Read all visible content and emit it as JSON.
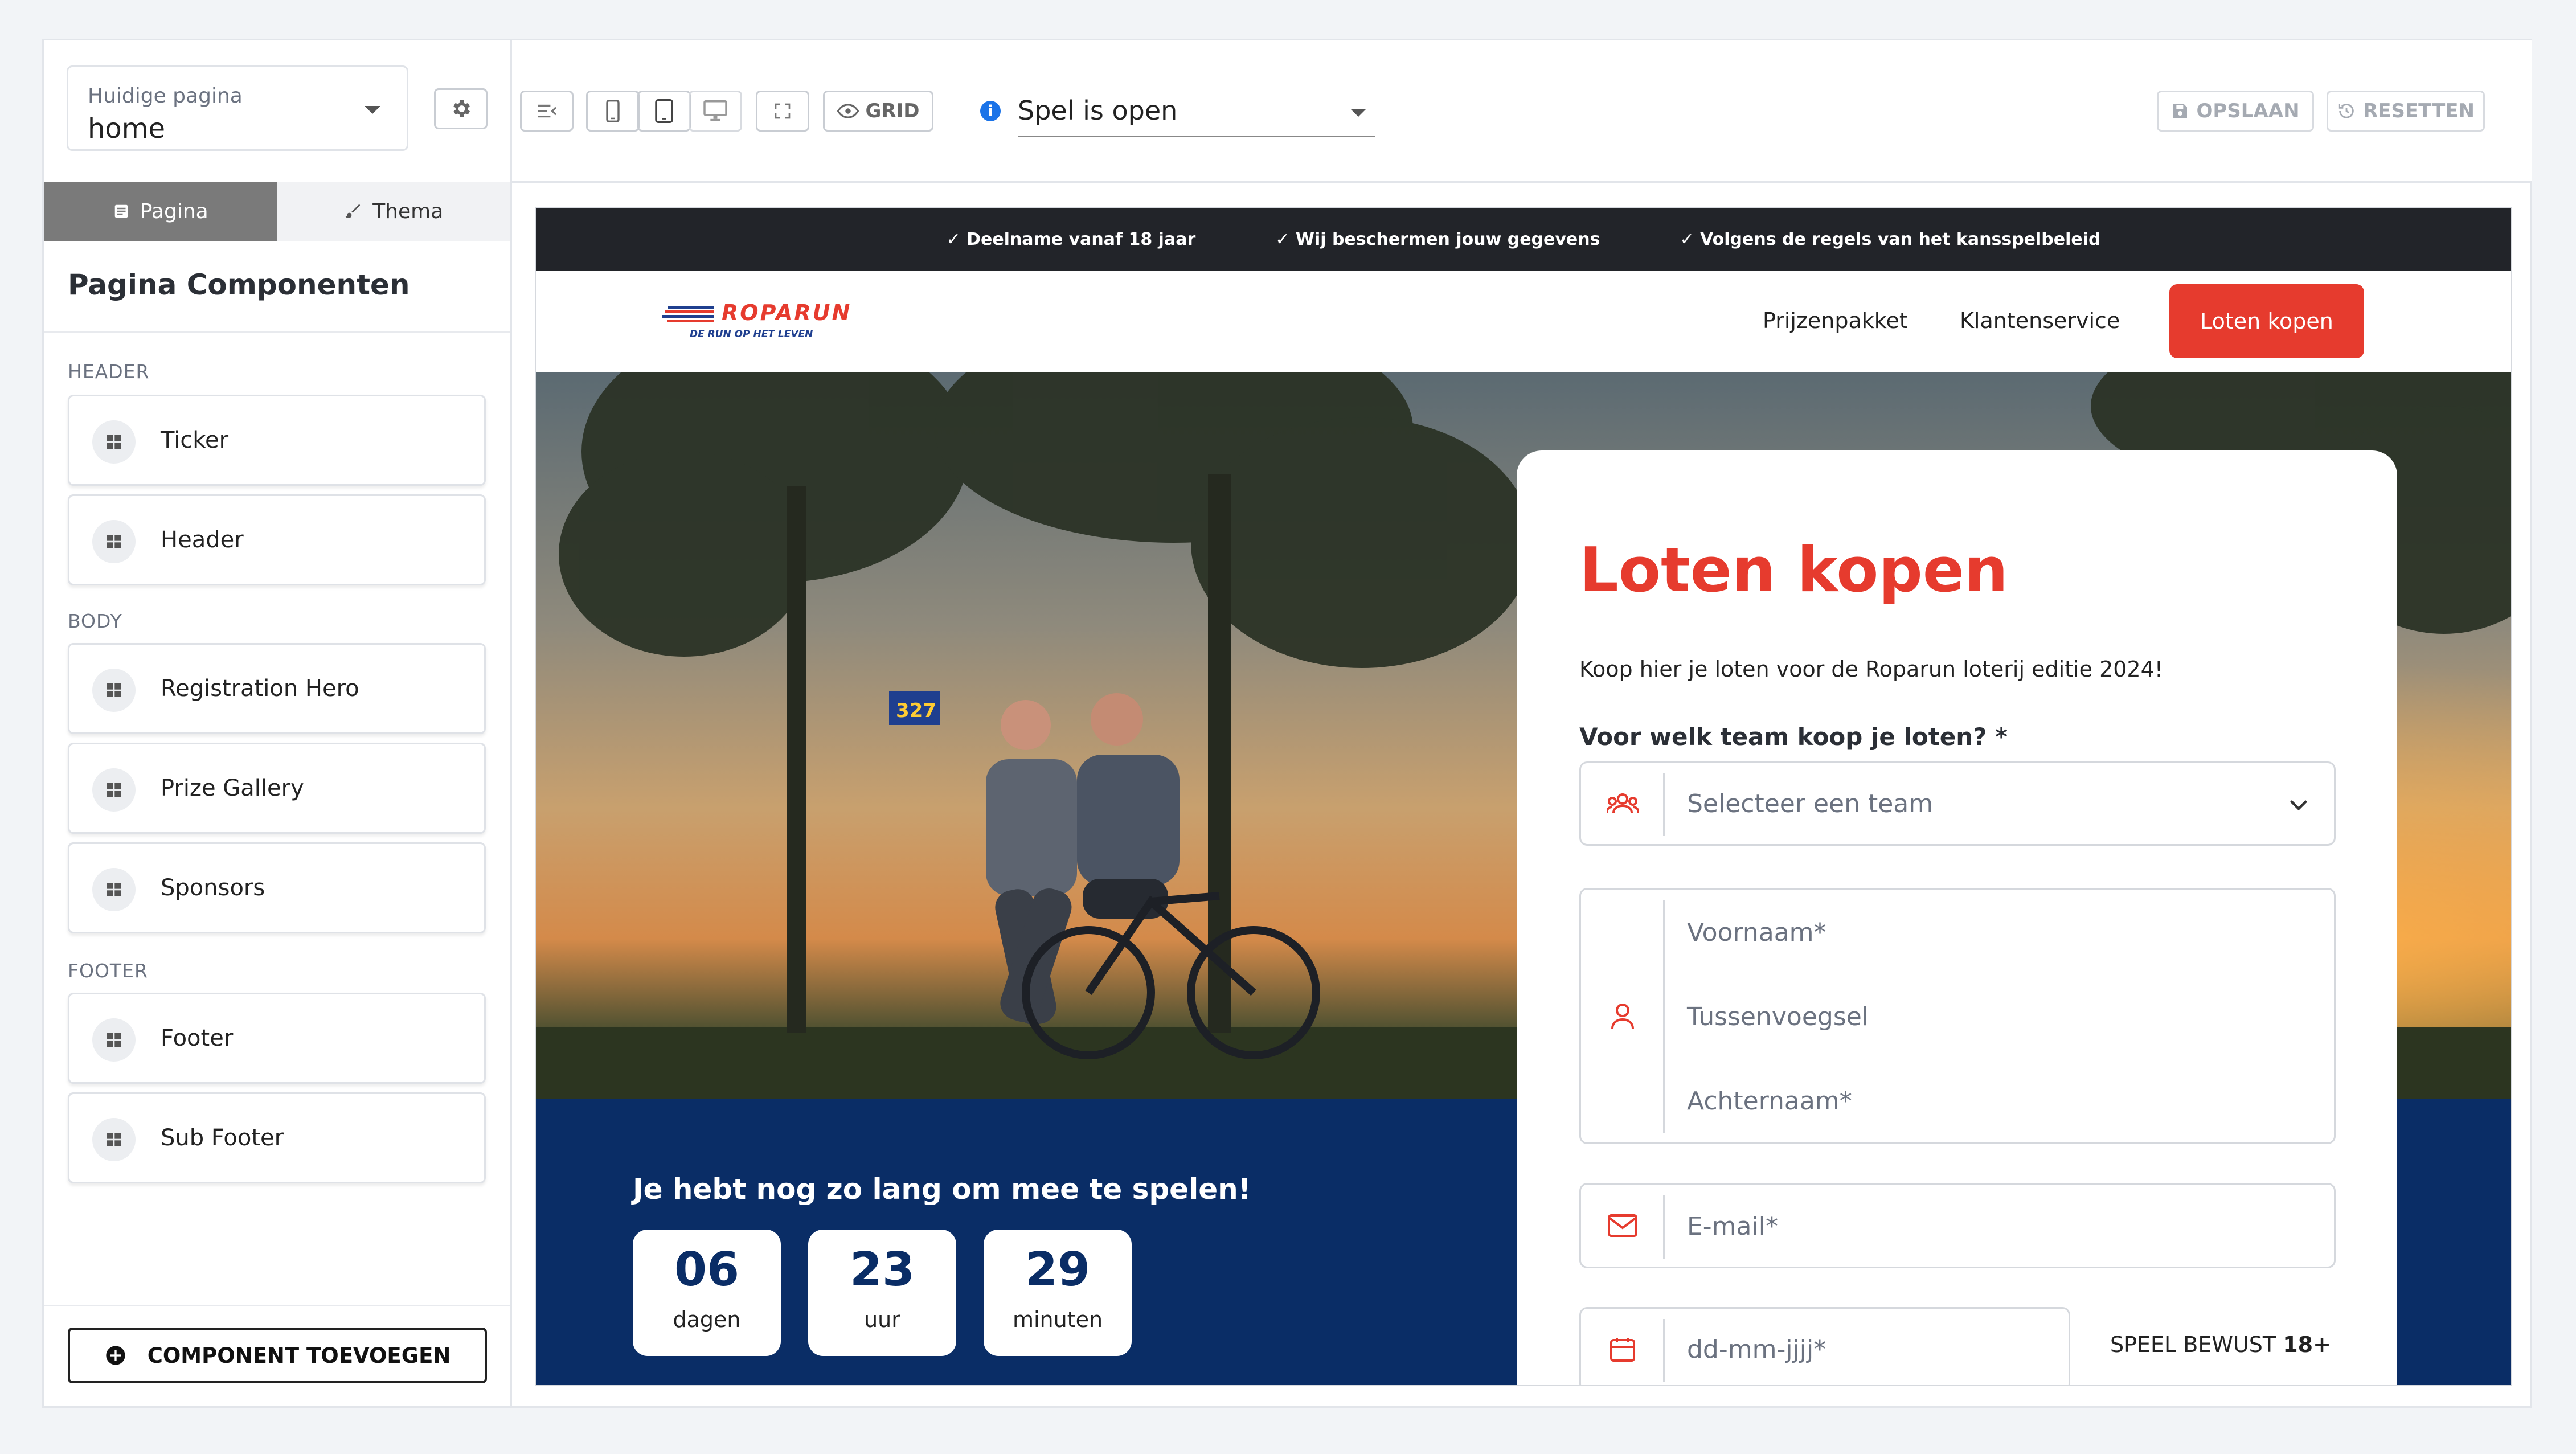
{
  "sidebar": {
    "page_select": {
      "label": "Huidige pagina",
      "value": "home"
    },
    "tabs": [
      {
        "label": "Pagina"
      },
      {
        "label": "Thema"
      }
    ],
    "section_title": "Pagina Componenten",
    "groups": {
      "header": {
        "label": "HEADER",
        "items": [
          "Ticker",
          "Header"
        ]
      },
      "body": {
        "label": "BODY",
        "items": [
          "Registration Hero",
          "Prize Gallery",
          "Sponsors"
        ]
      },
      "footer": {
        "label": "FOOTER",
        "items": [
          "Footer",
          "Sub Footer"
        ]
      }
    },
    "add_button": "COMPONENT TOEVOEGEN"
  },
  "toolbar": {
    "grid_label": "GRID",
    "state_value": "Spel is open",
    "save_label": "OPSLAAN",
    "reset_label": "RESETTEN"
  },
  "preview": {
    "ticker": [
      "✓ Deelname vanaf 18 jaar",
      "✓ Wij beschermen jouw gegevens",
      "✓ Volgens de regels van het kansspelbeleid"
    ],
    "logo": {
      "name": "ROPARUN",
      "tagline": "DE RUN OP HET LEVEN"
    },
    "nav": [
      "Prijzenpakket",
      "Klantenservice"
    ],
    "cta": "Loten kopen",
    "hero_sign": "327",
    "countdown": {
      "title": "Je hebt nog zo lang om mee te spelen!",
      "boxes": [
        {
          "value": "06",
          "unit": "dagen"
        },
        {
          "value": "23",
          "unit": "uur"
        },
        {
          "value": "29",
          "unit": "minuten"
        }
      ]
    },
    "form": {
      "title": "Loten kopen",
      "subtitle": "Koop hier je loten voor de Roparun loterij editie 2024!",
      "question": "Voor welk team koop je loten? *",
      "team_placeholder": "Selecteer een team",
      "first_name": "Voornaam*",
      "middle_name": "Tussenvoegsel",
      "last_name": "Achternaam*",
      "email": "E-mail*",
      "dob": "dd-mm-jjjj*",
      "speel_bewust": "SPEEL BEWUST",
      "age": "18+"
    }
  },
  "colors": {
    "brand_red": "#e63b2e",
    "brand_blue": "#0a2d66",
    "ticker_bg": "#222429",
    "active_tab": "#7a7a7a"
  }
}
